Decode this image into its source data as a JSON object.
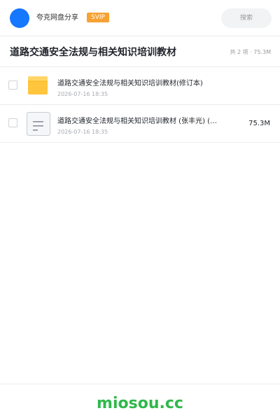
{
  "header": {
    "username": "夸克网盘分享",
    "badge": "SVIP",
    "search_placeholder": "搜索"
  },
  "title_bar": {
    "title": "道路交通安全法规与相关知识培训教材",
    "summary": "共 2 项 · 75.3M"
  },
  "files": [
    {
      "name": "道路交通安全法规与相关知识培训教材(修订本)",
      "date": "2026-07-16 18:35",
      "size": "",
      "icon": "folder-icon",
      "icon_color": "#ffc53d"
    },
    {
      "name": "道路交通安全法规与相关知识培训教材 (张丰光) (…",
      "date": "2026-07-16 18:35",
      "size": "75.3M",
      "icon": "document-icon",
      "icon_color": "#f5f6f8"
    }
  ],
  "footer": {
    "brand": "miosou.cc",
    "brand_color": "#2fb84a"
  },
  "colors": {
    "avatar": "#1677ff",
    "badge": "#f7a233"
  }
}
